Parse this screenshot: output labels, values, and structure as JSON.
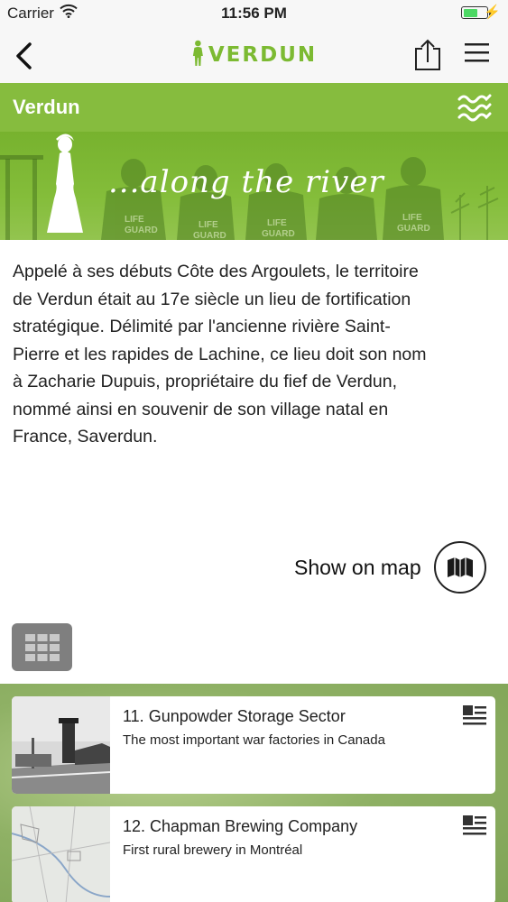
{
  "status_bar": {
    "carrier": "Carrier",
    "time": "11:56 PM",
    "battery_level": 0.6
  },
  "nav": {
    "logo_text": "VERDUN"
  },
  "section": {
    "title": "Verdun"
  },
  "banner": {
    "text": "...along the river"
  },
  "description": "Appelé à ses débuts Côte des Argoulets, le territoire\nde Verdun était au 17e siècle un lieu de fortification\nstratégique. Délimité par l'ancienne rivière Saint-\nPierre et les rapides de Lachine, ce lieu doit son nom\nà  Zacharie Dupuis, propriétaire du fief de Verdun,\nnommé ainsi en souvenir de son village natal en\nFrance, Saverdun.",
  "show_map": {
    "label": "Show on map"
  },
  "list": [
    {
      "title": "11. Gunpowder Storage Sector",
      "subtitle": "The most important war factories in Canada"
    },
    {
      "title": "12. Chapman Brewing Company",
      "subtitle": "First rural brewery in Montréal"
    }
  ],
  "colors": {
    "accent_green": "#86bc3e",
    "logo_green": "#7cba32",
    "grid_button": "#7f7f7f"
  }
}
